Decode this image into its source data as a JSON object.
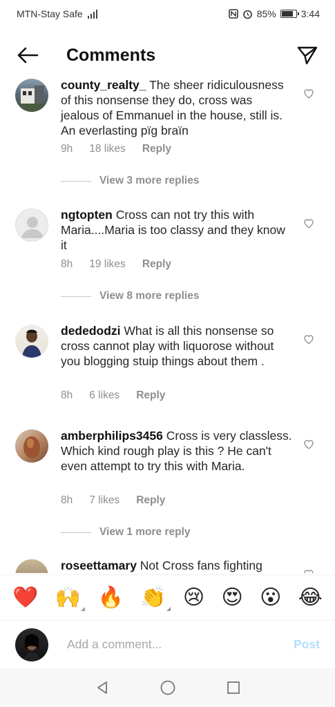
{
  "status_bar": {
    "carrier": "MTN-Stay Safe",
    "battery": "85%",
    "battery_level": 0.85,
    "time": "3:44"
  },
  "header": {
    "title": "Comments",
    "back_icon": "back-arrow-icon",
    "send_icon": "direct-message-icon"
  },
  "comments": [
    {
      "username": "county_realty_",
      "text": "The sheer ridiculousness of this nonsense they do, cross was jealous of Emmanuel in the house, still is. An everlasting pïg braïn",
      "time": "9h",
      "likes": "18 likes",
      "reply": "Reply",
      "view_replies": "View 3 more replies"
    },
    {
      "username": "ngtopten",
      "text": "Cross can not try this with Maria....Maria is too classy and they know it",
      "time": "8h",
      "likes": "19 likes",
      "reply": "Reply",
      "view_replies": "View 8 more replies"
    },
    {
      "username": "dededodzi",
      "text": "What is all this nonsense so  cross cannot  play with liquorose without  you blogging  stuip things about them .",
      "time": "8h",
      "likes": "6 likes",
      "reply": "Reply"
    },
    {
      "username": "amberphilips3456",
      "text": "Cross is very classless. Which kind rough play is this ? He can't even attempt to try this with Maria.",
      "time": "8h",
      "likes": "7 likes",
      "reply": "Reply",
      "view_replies": "View 1 more reply"
    },
    {
      "username": "roseettamary",
      "text": "Not Cross fans fighting"
    }
  ],
  "emoji_bar": [
    "❤️",
    "🙌",
    "🔥",
    "👏",
    "😢",
    "😍",
    "😮",
    "😂"
  ],
  "composer": {
    "placeholder": "Add a comment...",
    "post_label": "Post"
  }
}
